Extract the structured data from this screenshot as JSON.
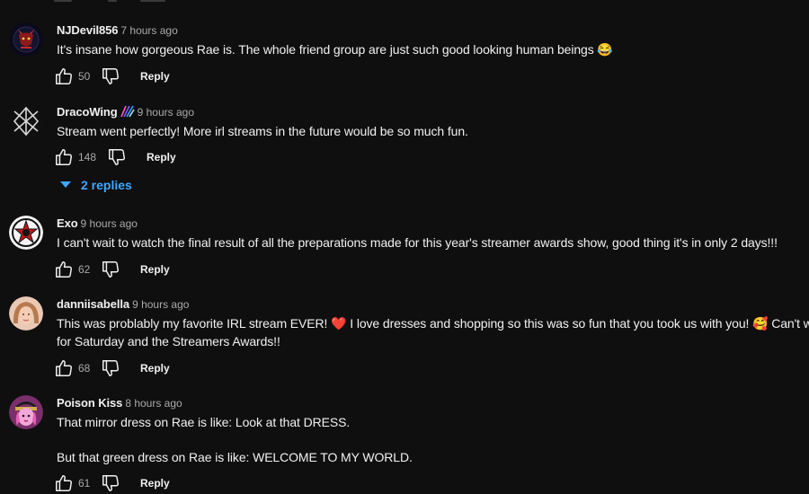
{
  "accent_color": "#3ea6ff",
  "comments": [
    {
      "author": "NJDevil856",
      "time": "7 hours ago",
      "text": [
        "It's insane how gorgeous Rae is. The whole friend group  are just such good looking human beings 😂"
      ],
      "likes": "50",
      "reply_label": "Reply",
      "avatar_icon": "devil-logo-avatar"
    },
    {
      "author": "DracoWing",
      "author_badge_icon": "rainbow-badge-icon",
      "time": "9 hours ago",
      "text": [
        "Stream went perfectly! More irl streams in the future would be so much fun."
      ],
      "likes": "148",
      "reply_label": "Reply",
      "replies_label": "2 replies",
      "avatar_icon": "geometric-logo-avatar"
    },
    {
      "author": "Exo",
      "time": "9 hours ago",
      "text": [
        "I can't wait to watch the final result of all the preparations made for this year's streamer awards show, good thing it's in only 2 days!!!"
      ],
      "likes": "62",
      "reply_label": "Reply",
      "avatar_icon": "red-star-logo-avatar"
    },
    {
      "author": "danniisabella",
      "time": "9 hours ago",
      "text": [
        "This was problably my favorite IRL stream EVER! ❤️  I love dresses and shopping so this was so fun that you took us with you! 🥰  Can't wait",
        "for Saturday and the Streamers Awards!!"
      ],
      "likes": "68",
      "reply_label": "Reply",
      "avatar_icon": "portrait-avatar"
    },
    {
      "author": "Poison Kiss",
      "time": "8 hours ago",
      "text": [
        "That mirror dress on Rae is like: Look at that DRESS.",
        "But that green dress on Rae is like: WELCOME TO MY WORLD."
      ],
      "likes": "61",
      "reply_label": "Reply",
      "avatar_icon": "cartoon-character-avatar"
    }
  ]
}
